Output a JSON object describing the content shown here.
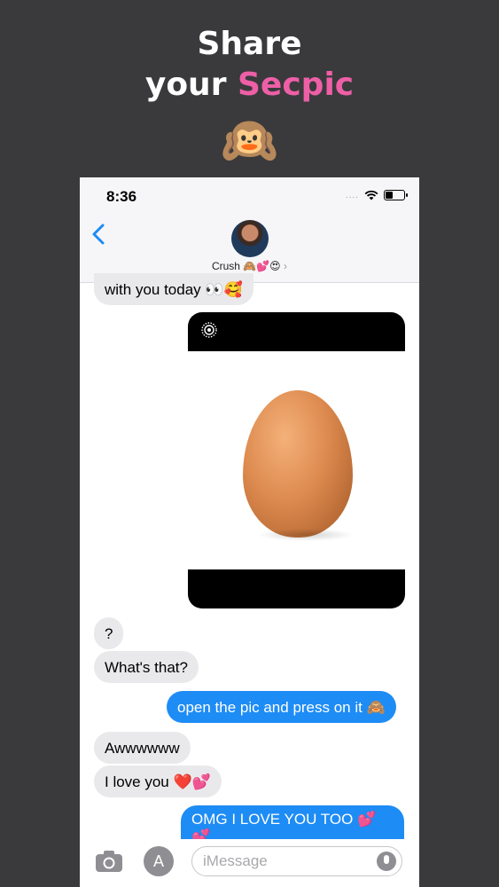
{
  "promo": {
    "line1": "Share",
    "line2_prefix": "your ",
    "line2_accent": "Secpic",
    "emoji": "🙉"
  },
  "status": {
    "time": "8:36",
    "signal": "....",
    "icons": [
      "wifi-icon",
      "battery-icon"
    ]
  },
  "conversation": {
    "contact_name": "Crush 🙈💕😍",
    "chevron": "›"
  },
  "messages": [
    {
      "from": "them",
      "text": "with you today 👀🥰"
    },
    {
      "from": "me",
      "type": "secret-photo"
    },
    {
      "from": "them",
      "text": "?"
    },
    {
      "from": "them",
      "text": "What's that?"
    },
    {
      "from": "me",
      "text": "open the pic and press on it 🙈"
    },
    {
      "from": "them",
      "text": "Awwwwww"
    },
    {
      "from": "them",
      "text": "I love you ❤️💕"
    },
    {
      "from": "me",
      "text_line1": "OMG I LOVE YOU TOO 💕💕",
      "text_line2": "💕💕😍😍"
    }
  ],
  "input": {
    "placeholder": "iMessage"
  },
  "colors": {
    "background": "#3a3a3c",
    "accent": "#ee5fa7",
    "sent": "#1e8cf5",
    "received": "#e9e9eb"
  }
}
